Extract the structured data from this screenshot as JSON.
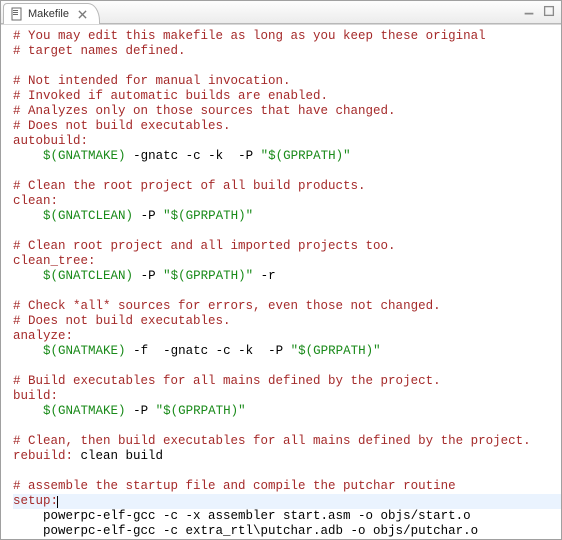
{
  "tab": {
    "label": "Makefile"
  },
  "lines": [
    [
      {
        "cls": "c-comment",
        "t": "# You may edit this makefile as long as you keep these original"
      }
    ],
    [
      {
        "cls": "c-comment",
        "t": "# target names defined."
      }
    ],
    [
      {
        "cls": "c-plain",
        "t": ""
      }
    ],
    [
      {
        "cls": "c-comment",
        "t": "# Not intended for manual invocation."
      }
    ],
    [
      {
        "cls": "c-comment",
        "t": "# Invoked if automatic builds are enabled."
      }
    ],
    [
      {
        "cls": "c-comment",
        "t": "# Analyzes only on those sources that have changed."
      }
    ],
    [
      {
        "cls": "c-comment",
        "t": "# Does not build executables."
      }
    ],
    [
      {
        "cls": "c-target",
        "t": "autobuild:"
      }
    ],
    [
      {
        "cls": "c-plain",
        "t": "    "
      },
      {
        "cls": "c-var",
        "t": "$("
      },
      {
        "cls": "c-varbr",
        "t": "GNATMAKE"
      },
      {
        "cls": "c-var",
        "t": ")"
      },
      {
        "cls": "c-plain",
        "t": " -gnatc -c -k  -P "
      },
      {
        "cls": "c-quote",
        "t": "\"$(GPRPATH)\""
      }
    ],
    [
      {
        "cls": "c-plain",
        "t": ""
      }
    ],
    [
      {
        "cls": "c-comment",
        "t": "# Clean the root project of all build products."
      }
    ],
    [
      {
        "cls": "c-target",
        "t": "clean:"
      }
    ],
    [
      {
        "cls": "c-plain",
        "t": "    "
      },
      {
        "cls": "c-var",
        "t": "$("
      },
      {
        "cls": "c-varbr",
        "t": "GNATCLEAN"
      },
      {
        "cls": "c-var",
        "t": ")"
      },
      {
        "cls": "c-plain",
        "t": " -P "
      },
      {
        "cls": "c-quote",
        "t": "\"$(GPRPATH)\""
      }
    ],
    [
      {
        "cls": "c-plain",
        "t": ""
      }
    ],
    [
      {
        "cls": "c-comment",
        "t": "# Clean root project and all imported projects too."
      }
    ],
    [
      {
        "cls": "c-target",
        "t": "clean_tree:"
      }
    ],
    [
      {
        "cls": "c-plain",
        "t": "    "
      },
      {
        "cls": "c-var",
        "t": "$("
      },
      {
        "cls": "c-varbr",
        "t": "GNATCLEAN"
      },
      {
        "cls": "c-var",
        "t": ")"
      },
      {
        "cls": "c-plain",
        "t": " -P "
      },
      {
        "cls": "c-quote",
        "t": "\"$(GPRPATH)\""
      },
      {
        "cls": "c-plain",
        "t": " -r"
      }
    ],
    [
      {
        "cls": "c-plain",
        "t": ""
      }
    ],
    [
      {
        "cls": "c-comment",
        "t": "# Check *all* sources for errors, even those not changed."
      }
    ],
    [
      {
        "cls": "c-comment",
        "t": "# Does not build executables."
      }
    ],
    [
      {
        "cls": "c-target",
        "t": "analyze:"
      }
    ],
    [
      {
        "cls": "c-plain",
        "t": "    "
      },
      {
        "cls": "c-var",
        "t": "$("
      },
      {
        "cls": "c-varbr",
        "t": "GNATMAKE"
      },
      {
        "cls": "c-var",
        "t": ")"
      },
      {
        "cls": "c-plain",
        "t": " -f  -gnatc -c -k  -P "
      },
      {
        "cls": "c-quote",
        "t": "\"$(GPRPATH)\""
      }
    ],
    [
      {
        "cls": "c-plain",
        "t": ""
      }
    ],
    [
      {
        "cls": "c-comment",
        "t": "# Build executables for all mains defined by the project."
      }
    ],
    [
      {
        "cls": "c-target",
        "t": "build:"
      }
    ],
    [
      {
        "cls": "c-plain",
        "t": "    "
      },
      {
        "cls": "c-var",
        "t": "$("
      },
      {
        "cls": "c-varbr",
        "t": "GNATMAKE"
      },
      {
        "cls": "c-var",
        "t": ")"
      },
      {
        "cls": "c-plain",
        "t": " -P "
      },
      {
        "cls": "c-quote",
        "t": "\"$(GPRPATH)\""
      }
    ],
    [
      {
        "cls": "c-plain",
        "t": ""
      }
    ],
    [
      {
        "cls": "c-comment",
        "t": "# Clean, then build executables for all mains defined by the project."
      }
    ],
    [
      {
        "cls": "c-target",
        "t": "rebuild:"
      },
      {
        "cls": "c-plain",
        "t": " "
      },
      {
        "cls": "c-plain",
        "t": "clean build"
      }
    ],
    [
      {
        "cls": "c-plain",
        "t": ""
      }
    ],
    [
      {
        "cls": "c-comment",
        "t": "# assemble the startup file and compile the putchar routine"
      }
    ],
    [
      {
        "cls": "c-target",
        "t": "setup:"
      }
    ],
    [
      {
        "cls": "c-plain",
        "t": "    powerpc-elf-gcc -c -x assembler start.asm -o objs/start.o"
      }
    ],
    [
      {
        "cls": "c-plain",
        "t": "    powerpc-elf-gcc -c extra_rtl\\putchar.adb -o objs/putchar.o"
      }
    ]
  ],
  "highlight_line_index": 31
}
